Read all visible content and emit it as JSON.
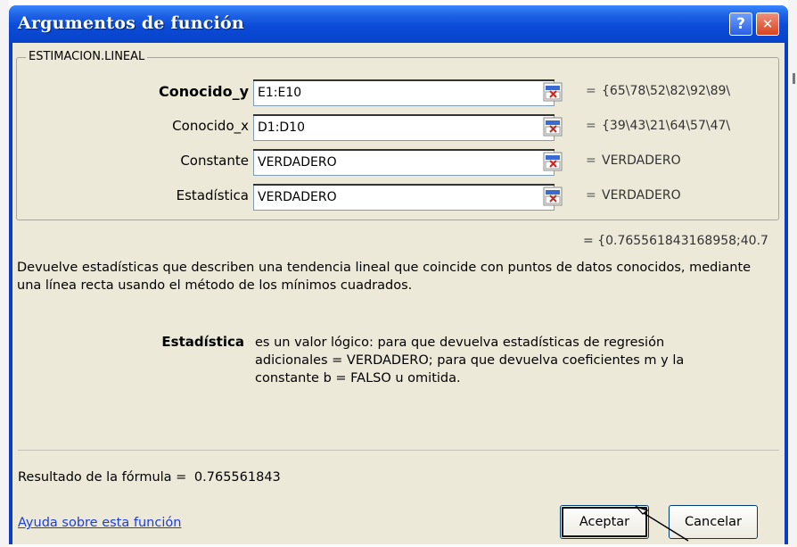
{
  "window": {
    "title": "Argumentos de función",
    "help_button_label": "?",
    "close_button_label": "✕"
  },
  "function": {
    "name": "ESTIMACION.LINEAL",
    "arguments": [
      {
        "label": "Conocido_y",
        "bold": true,
        "input_value": "E1:E10",
        "evaluated": "{65\\78\\52\\82\\92\\89\\"
      },
      {
        "label": "Conocido_x",
        "bold": false,
        "input_value": "D1:D10",
        "evaluated": "{39\\43\\21\\64\\57\\47\\"
      },
      {
        "label": "Constante",
        "bold": false,
        "input_value": "VERDADERO",
        "evaluated": "VERDADERO"
      },
      {
        "label": "Estadística",
        "bold": false,
        "input_value": "VERDADERO",
        "evaluated": "VERDADERO"
      }
    ],
    "equals_sign": "=",
    "overall_result_preview": "= {0.765561843168958;40.7",
    "description": "Devuelve estadísticas que describen una tendencia lineal que coincide con puntos de datos conocidos, mediante una línea recta usando el método de los mínimos cuadrados.",
    "selected_param_name": "Estadística",
    "selected_param_description": "es un valor lógico: para que devuelva estadísticas de regresión adicionales = VERDADERO; para que devuelva coeficientes m y la constante b = FALSO u omitida."
  },
  "footer": {
    "result_label": "Resultado de la fórmula =",
    "result_value": "0.765561843",
    "help_link": "Ayuda sobre esta función",
    "ok_button": "Aceptar",
    "cancel_button": "Cancelar"
  },
  "colors": {
    "titlebar": "#0b4bd8",
    "dialog_background": "#ece9d8",
    "link": "#1c3fd6",
    "close_button": "#d8431e"
  }
}
